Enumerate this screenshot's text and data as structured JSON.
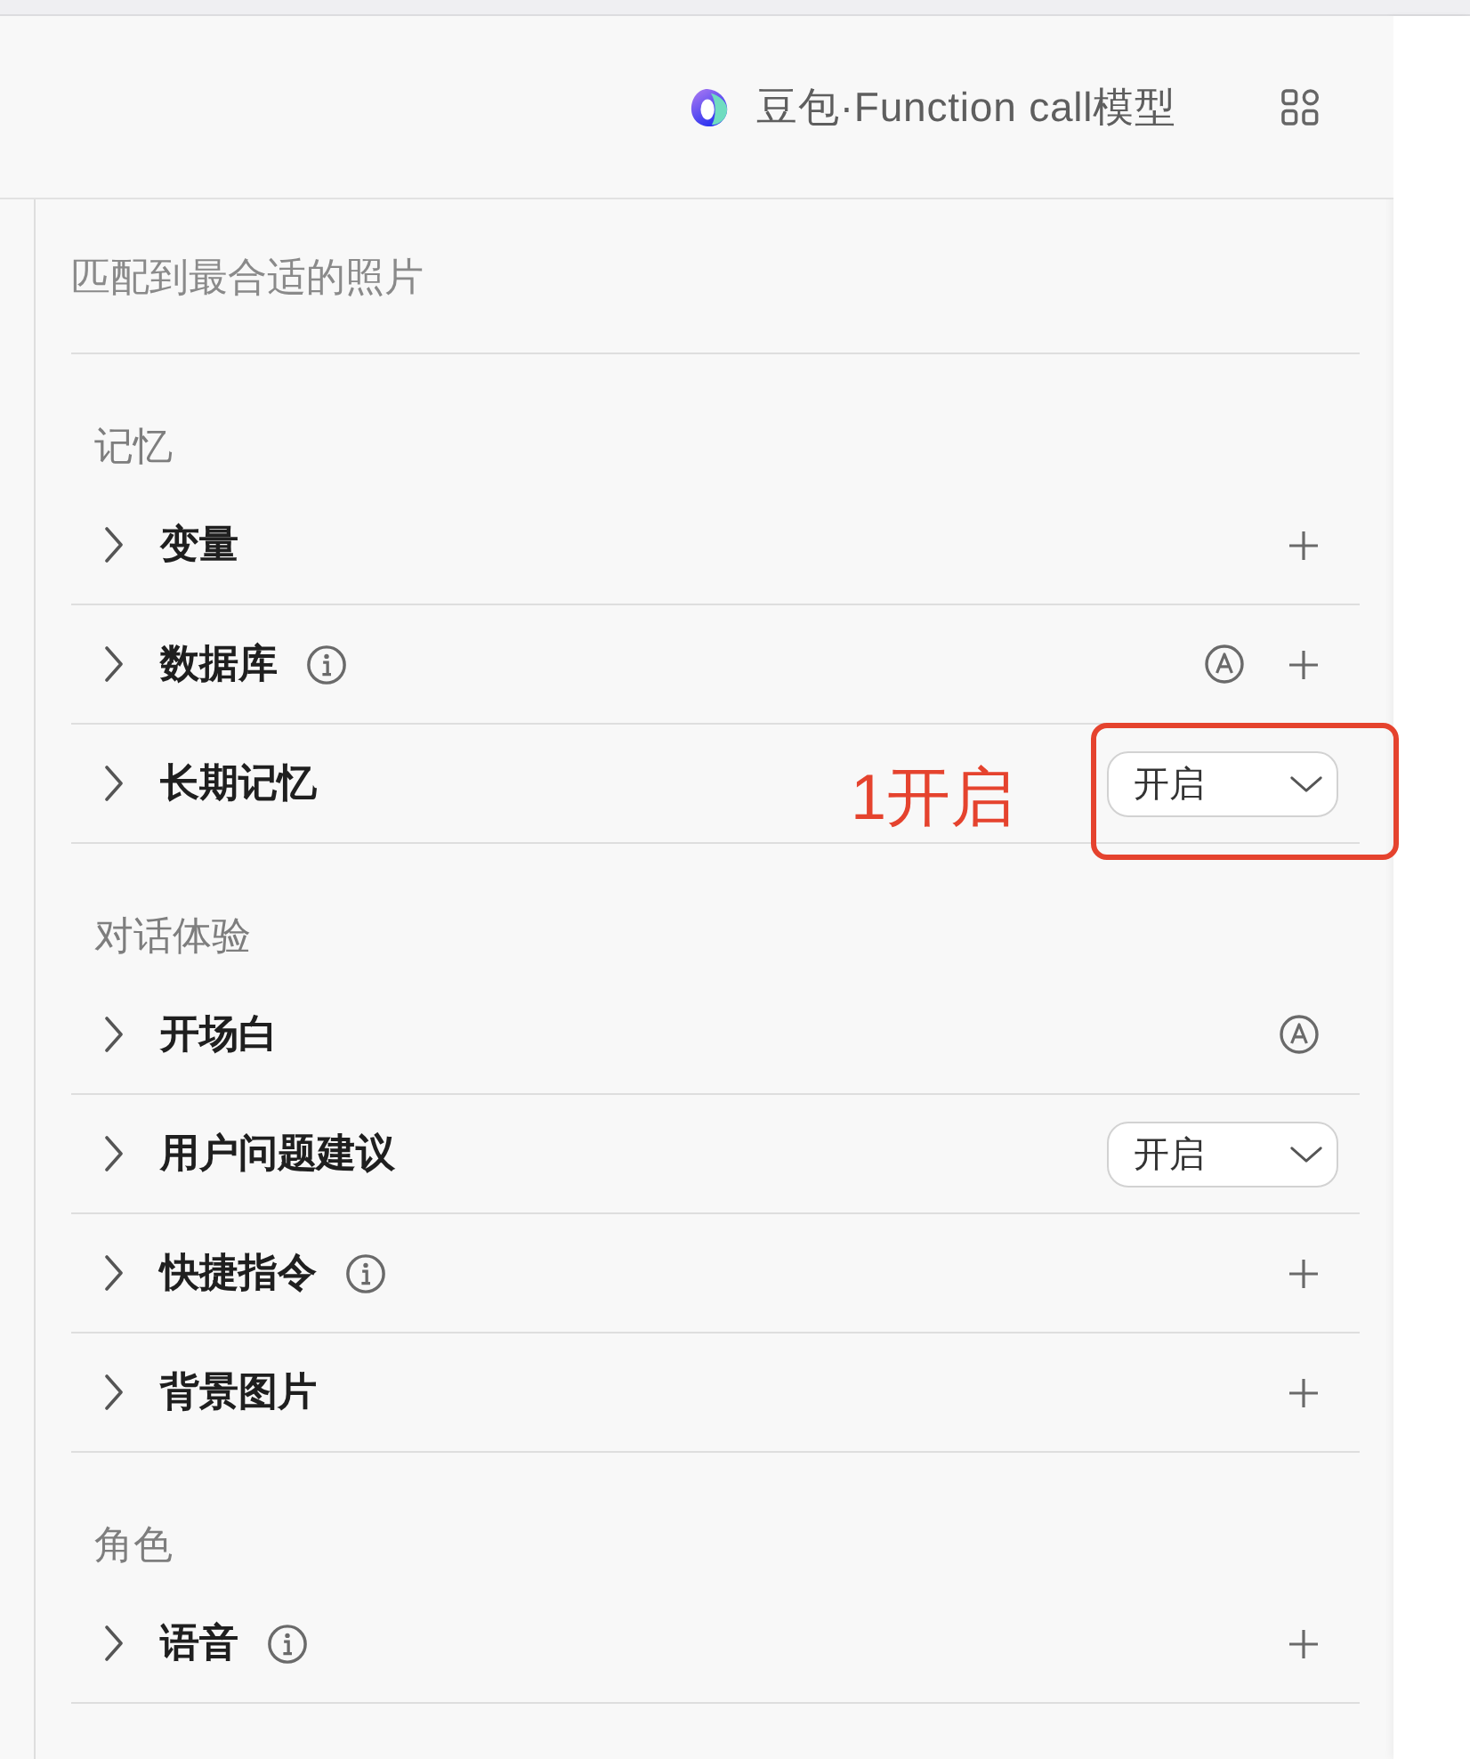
{
  "header": {
    "model_name": "豆包·Function call模型"
  },
  "description": "匹配到最合适的照片",
  "sections": [
    {
      "title": "记忆",
      "items": [
        {
          "label": "变量",
          "expanded": false,
          "actions": [
            {
              "kind": "add"
            }
          ]
        },
        {
          "label": "数据库",
          "expanded": false,
          "label_icons": [
            {
              "kind": "info"
            }
          ],
          "actions": [
            {
              "kind": "auto"
            },
            {
              "kind": "add"
            }
          ]
        },
        {
          "label": "长期记忆",
          "expanded": false,
          "actions": [
            {
              "kind": "select",
              "value": "开启"
            }
          ],
          "annotation": {
            "text": "1开启"
          }
        }
      ]
    },
    {
      "title": "对话体验",
      "items": [
        {
          "label": "开场白",
          "expanded": false,
          "actions": [
            {
              "kind": "auto"
            }
          ]
        },
        {
          "label": "用户问题建议",
          "expanded": false,
          "actions": [
            {
              "kind": "select",
              "value": "开启"
            }
          ]
        },
        {
          "label": "快捷指令",
          "expanded": false,
          "label_icons": [
            {
              "kind": "info"
            }
          ],
          "actions": [
            {
              "kind": "add"
            }
          ]
        },
        {
          "label": "背景图片",
          "expanded": false,
          "actions": [
            {
              "kind": "add"
            }
          ]
        }
      ]
    },
    {
      "title": "角色",
      "items": [
        {
          "label": "语音",
          "expanded": false,
          "label_icons": [
            {
              "kind": "info"
            }
          ],
          "actions": [
            {
              "kind": "add"
            }
          ]
        }
      ]
    }
  ]
}
